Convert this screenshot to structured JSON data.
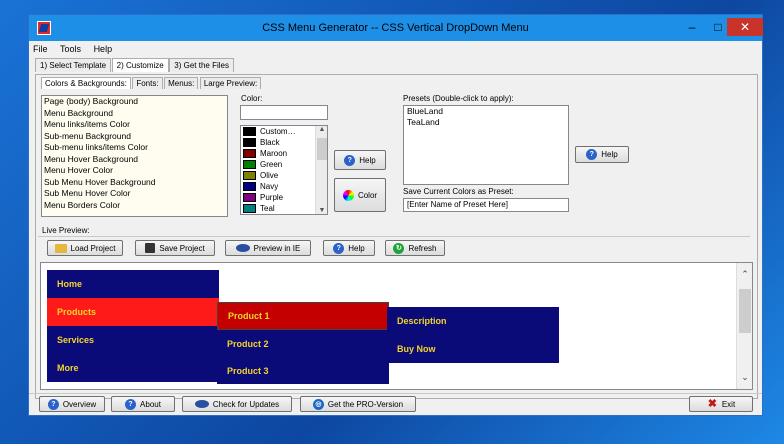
{
  "window": {
    "title": "CSS Menu Generator -- CSS Vertical DropDown Menu",
    "controls": {
      "minimize": "–",
      "maximize": "□",
      "close": "✕"
    }
  },
  "menubar": [
    "File",
    "Tools",
    "Help"
  ],
  "tabs": [
    "1) Select Template",
    "2) Customize",
    "3) Get the Files"
  ],
  "inner_tabs": [
    "Colors & Backgrounds:",
    "Fonts:",
    "Menus:",
    "Large Preview:"
  ],
  "elements_list": [
    "Page (body) Background",
    "Menu Background",
    "Menu links/items Color",
    "Sub-menu Background",
    "Sub-menu links/items Color",
    "Menu Hover Background",
    "Menu Hover Color",
    "Sub Menu Hover Background",
    "Sub Menu Hover Color",
    "Menu Borders Color"
  ],
  "color_section": {
    "label": "Color:",
    "value": "",
    "colors": [
      {
        "name": "Custom…",
        "hex": "#000000"
      },
      {
        "name": "Black",
        "hex": "#000000"
      },
      {
        "name": "Maroon",
        "hex": "#800000"
      },
      {
        "name": "Green",
        "hex": "#008000"
      },
      {
        "name": "Olive",
        "hex": "#808000"
      },
      {
        "name": "Navy",
        "hex": "#000080"
      },
      {
        "name": "Purple",
        "hex": "#800080"
      },
      {
        "name": "Teal",
        "hex": "#008080"
      }
    ],
    "help_button": "Help",
    "color_button": "Color"
  },
  "presets": {
    "label": "Presets (Double-click to apply):",
    "items": [
      "BlueLand",
      "TeaLand"
    ],
    "help_button": "Help",
    "save_label": "Save Current Colors as Preset:",
    "save_input": "[Enter Name of Preset Here]"
  },
  "live_preview": {
    "label": "Live Preview:",
    "buttons": [
      "Load Project",
      "Save Project",
      "Preview in IE",
      "Help",
      "Refresh"
    ],
    "menu": {
      "items": [
        "Home",
        "Products",
        "Services",
        "More"
      ],
      "submenu": [
        "Product 1",
        "Product 2",
        "Product 3"
      ],
      "subsubmenu": [
        "Description",
        "Buy Now"
      ],
      "colors": {
        "menu_bg": "#0a0a78",
        "hover_bg": "#ff1a1a",
        "sub_hover_bg": "#c40000",
        "text": "#f2d52a"
      }
    }
  },
  "footer": {
    "buttons": [
      "Overview",
      "About",
      "Check for Updates",
      "Get the PRO-Version"
    ],
    "exit_button": "Exit"
  }
}
